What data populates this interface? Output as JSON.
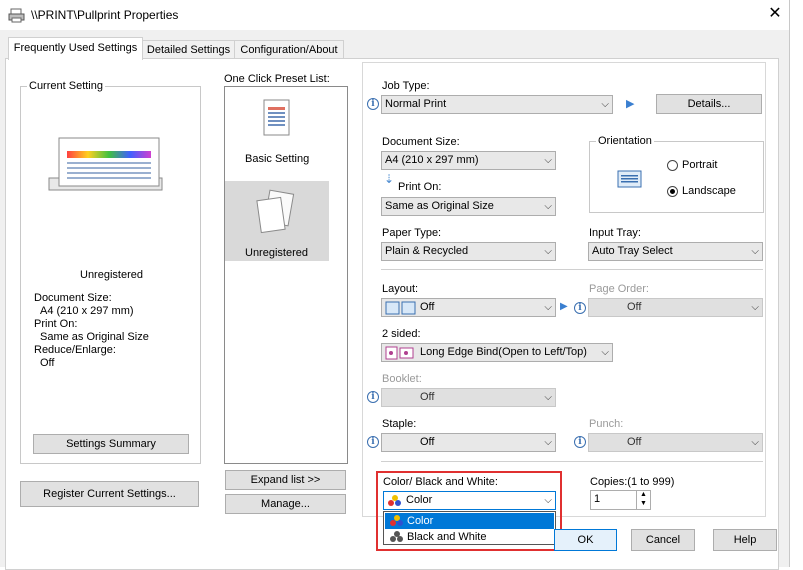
{
  "window": {
    "title": "\\\\PRINT\\Pullprint Properties",
    "tabs": [
      "Frequently Used Settings",
      "Detailed Settings",
      "Configuration/About"
    ]
  },
  "current_setting": {
    "label": "Current Setting",
    "name": "Unregistered",
    "details": [
      {
        "label": "Document Size:",
        "value": "A4 (210 x 297 mm)"
      },
      {
        "label": "Print On:",
        "value": "Same as Original Size"
      },
      {
        "label": "Reduce/Enlarge:",
        "value": "Off"
      }
    ],
    "summary_button": "Settings Summary",
    "register_button": "Register Current Settings..."
  },
  "presets": {
    "label": "One Click Preset List:",
    "items": [
      "Basic Setting",
      "Unregistered"
    ],
    "expand_button": "Expand list >>",
    "manage_button": "Manage..."
  },
  "job_type": {
    "label": "Job Type:",
    "value": "Normal Print",
    "details_button": "Details..."
  },
  "document_size": {
    "label": "Document Size:",
    "value": "A4 (210 x 297 mm)"
  },
  "print_on": {
    "label": "Print On:",
    "value": "Same as Original Size"
  },
  "orientation": {
    "label": "Orientation",
    "options": [
      "Portrait",
      "Landscape"
    ],
    "selected": "Landscape"
  },
  "paper_type": {
    "label": "Paper Type:",
    "value": "Plain & Recycled"
  },
  "input_tray": {
    "label": "Input Tray:",
    "value": "Auto Tray Select"
  },
  "layout": {
    "label": "Layout:",
    "value": "Off"
  },
  "page_order": {
    "label": "Page Order:",
    "value": "Off"
  },
  "two_sided": {
    "label": "2 sided:",
    "value": "Long Edge Bind(Open to Left/Top)"
  },
  "booklet": {
    "label": "Booklet:",
    "value": "Off"
  },
  "staple": {
    "label": "Staple:",
    "value": "Off"
  },
  "punch": {
    "label": "Punch:",
    "value": "Off"
  },
  "color": {
    "label": "Color/ Black and White:",
    "value": "Color",
    "options": [
      "Color",
      "Black and White"
    ]
  },
  "copies": {
    "label": "Copies:(1 to 999)",
    "value": "1"
  },
  "buttons": {
    "ok": "OK",
    "cancel": "Cancel",
    "help": "Help"
  },
  "colors": {
    "highlight": "#0078d7",
    "focus_rect": "#e03030"
  }
}
